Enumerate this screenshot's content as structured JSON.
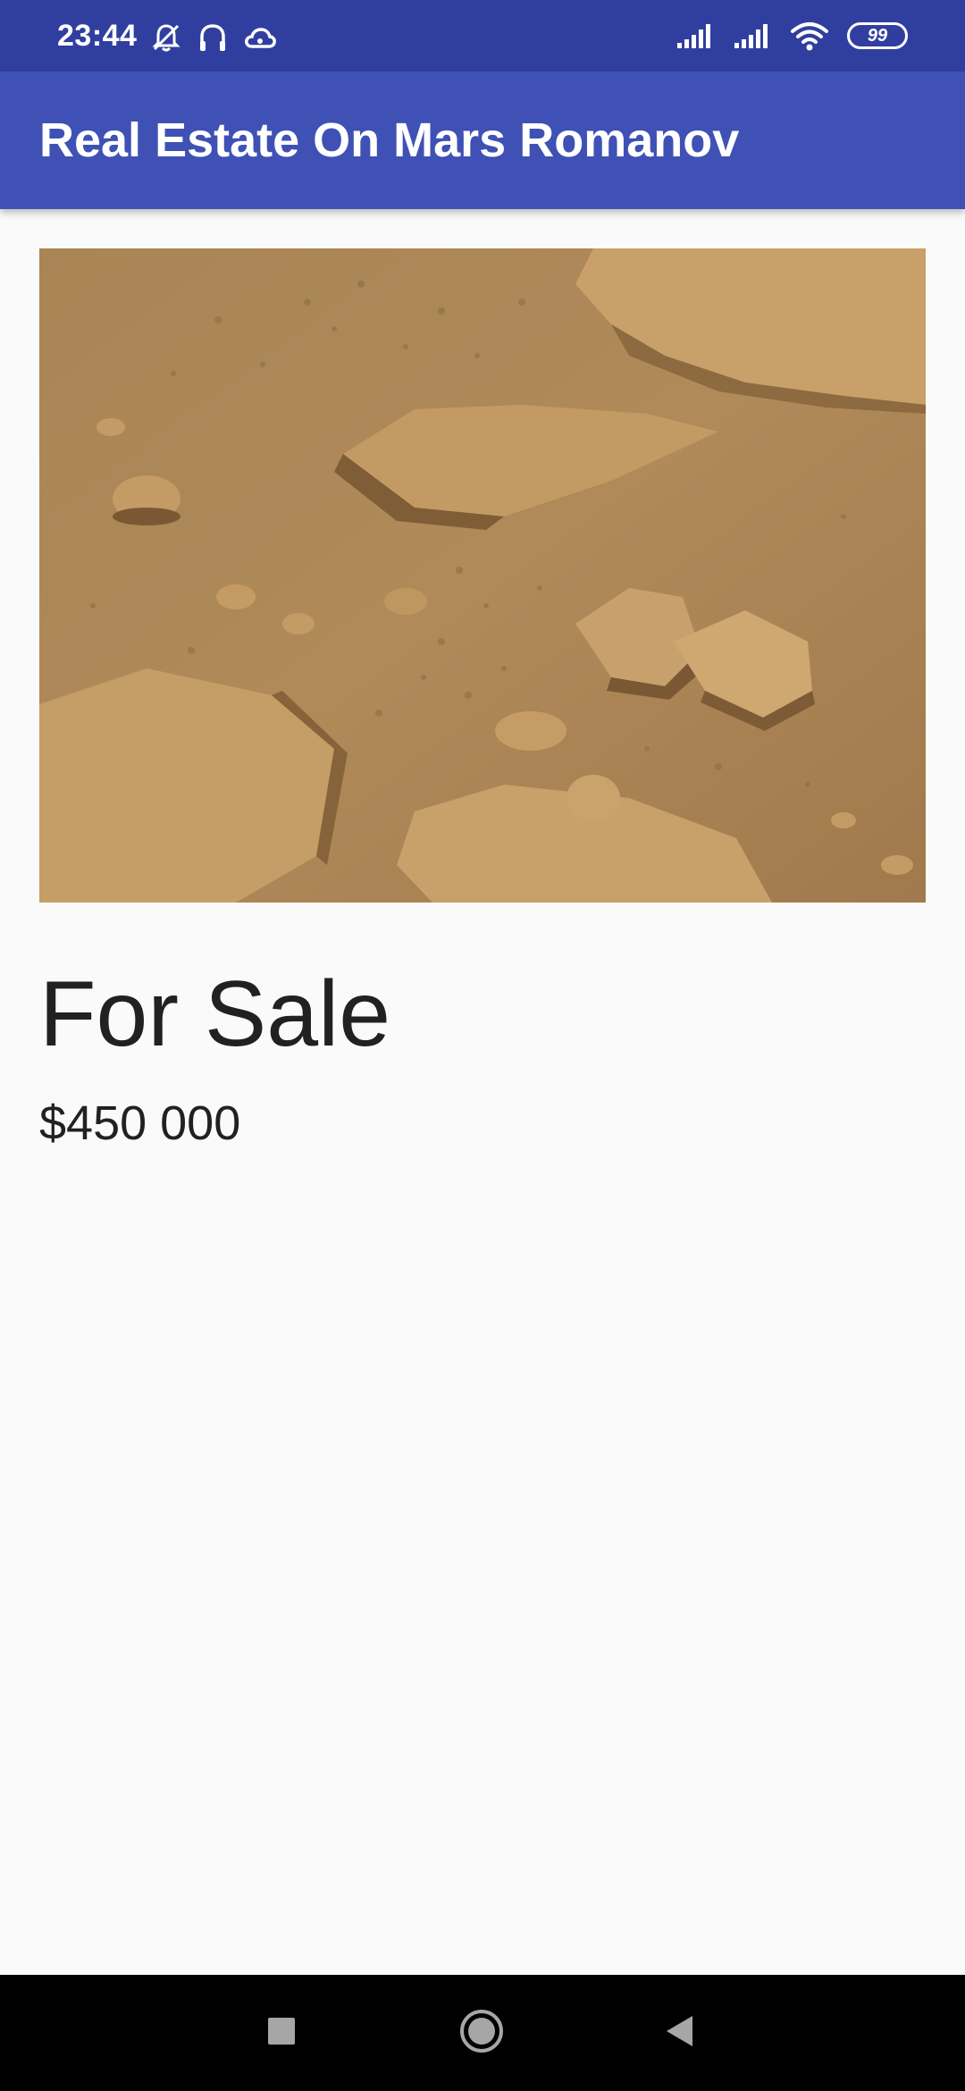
{
  "status_bar": {
    "time": "23:44",
    "left_icons": [
      "bell-off-icon",
      "headphones-icon",
      "cloud-icon"
    ],
    "right_icons": [
      "signal-icon",
      "signal-icon",
      "wifi-icon"
    ],
    "battery": "99"
  },
  "app_bar": {
    "title": "Real Estate On Mars Romanov"
  },
  "listing": {
    "photo_icon": "mars-terrain-image",
    "type": "For Sale",
    "price": "$450 000"
  },
  "nav_bar": {
    "recents_icon": "square-icon",
    "home_icon": "circle-icon",
    "back_icon": "triangle-back-icon"
  },
  "colors": {
    "status_bar": "#303f9f",
    "app_bar": "#3f51b5",
    "background": "#fafafa",
    "text": "#212121",
    "nav_bar": "#000000"
  }
}
